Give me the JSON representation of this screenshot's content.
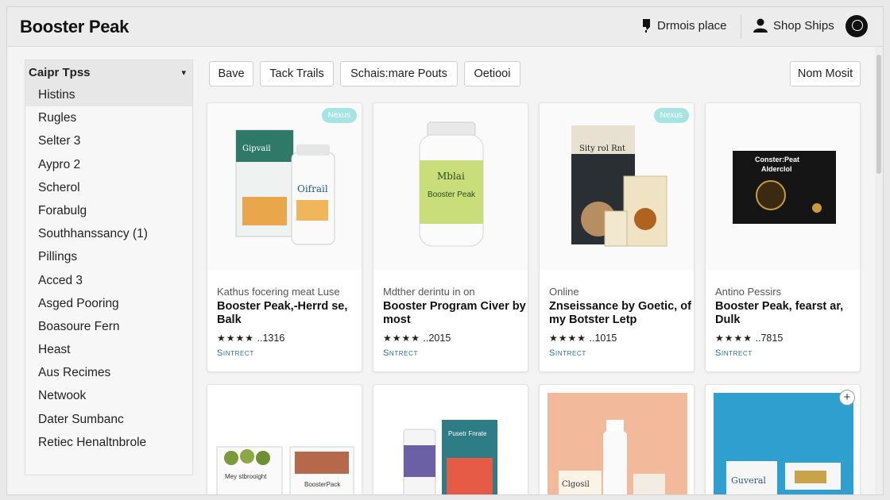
{
  "header": {
    "brand": "Booster Peak",
    "location_label": "Drmois place",
    "account_label": "Shop Ships"
  },
  "sidebar": {
    "heading": "Caipr Tpss",
    "items": [
      "Histins",
      "Rugles",
      "Selter 3",
      "Aypro 2",
      "Scherol",
      "Forabulg",
      "Southhanssancy (1)",
      "Pillings",
      "Acced 3",
      "Asged Pooring",
      "Boasoure Fern",
      "Heast",
      "Aus Recimes",
      "Netwook",
      "Dater Sumbanc",
      "Retiec Henaltnbrole"
    ]
  },
  "filters": [
    "Bave",
    "Tack Trails",
    "Schais:mare Pouts",
    "Oetiooi"
  ],
  "sort_label": "Nom Mosit",
  "products": [
    {
      "badge": "Nexus",
      "meta": "Kathus focering meat Luse",
      "title": "Booster Peak,-Herrd se, Balk",
      "stars": "★★★★",
      "count": "..1316",
      "cta": "Sintrect",
      "package_text": [
        "Gipvail",
        "Oifrail"
      ]
    },
    {
      "badge": "",
      "meta": "Mdther derintu in on",
      "title": "Booster Program Civer by most",
      "stars": "★★★★",
      "count": "..2015",
      "cta": "Sntrect",
      "package_text": [
        "Mblai",
        "Booster Peak"
      ]
    },
    {
      "badge": "Nexus",
      "meta": "Online",
      "title": "Znseissance by Goetic, of my Botster Letp",
      "stars": "★★★★",
      "count": "..1015",
      "cta": "Sintrect",
      "package_text": [
        "Sity rol Rnt"
      ]
    },
    {
      "badge": "",
      "meta": "Antino Pessirs",
      "title": "Booster Peak, fearst ar, Dulk",
      "stars": "★★★★",
      "count": "..7815",
      "cta": "Sintrect",
      "package_text": [
        "Conster:Peat",
        "Alderclol"
      ]
    },
    {
      "package_text": [
        "Mey stbrooight",
        "BoosterPack"
      ]
    },
    {
      "package_text": [
        "Pusetr Fnrate"
      ]
    },
    {
      "package_text": [
        "Clgosil"
      ]
    },
    {
      "package_text": [
        "Guveral"
      ]
    }
  ],
  "colors": {
    "badge": "#a6e4e3",
    "cta": "#2a6f8f",
    "tile_peach": "#f2b99a",
    "tile_blue": "#2f9fd0"
  }
}
